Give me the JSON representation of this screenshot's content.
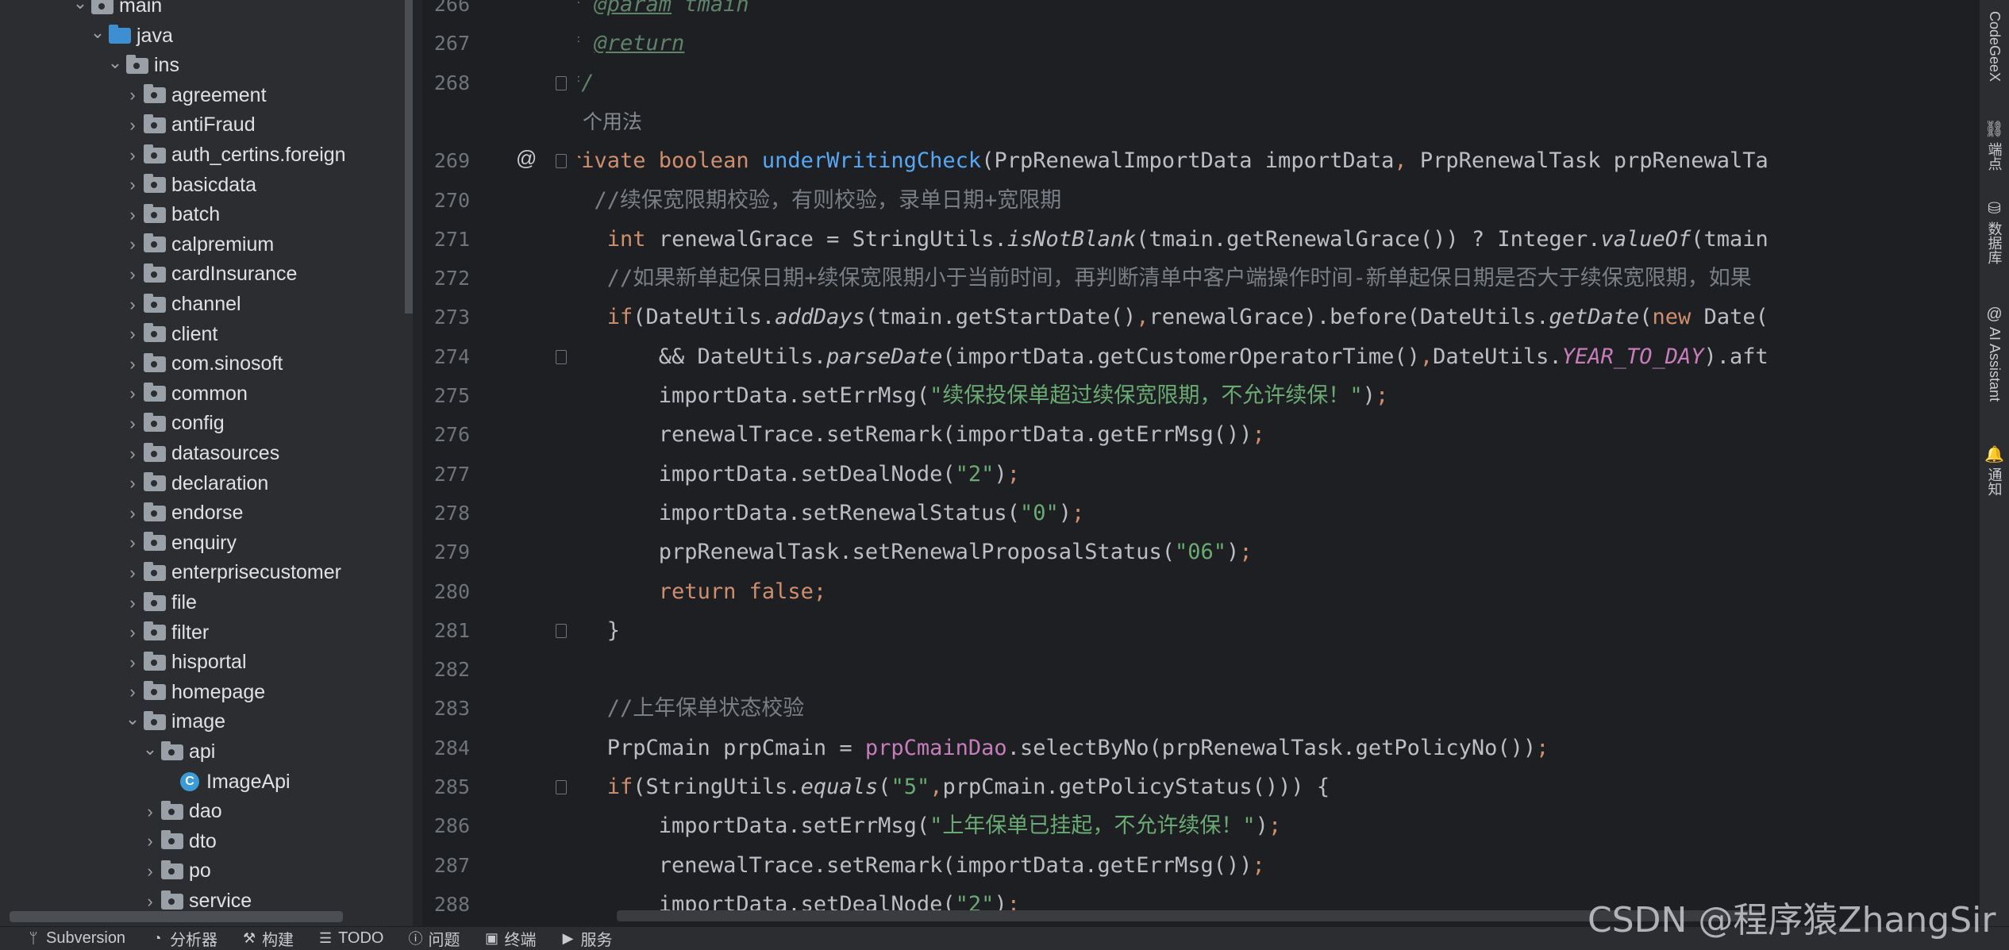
{
  "tree": {
    "items": [
      {
        "label": "main",
        "indent": 0,
        "expanded": true,
        "icon": "folder-icon"
      },
      {
        "label": "java",
        "indent": 1,
        "expanded": true,
        "icon": "source-folder-icon"
      },
      {
        "label": "ins",
        "indent": 2,
        "expanded": true,
        "icon": "package-icon"
      },
      {
        "label": "agreement",
        "indent": 3,
        "expanded": false,
        "icon": "package-icon"
      },
      {
        "label": "antiFraud",
        "indent": 3,
        "expanded": false,
        "icon": "package-icon"
      },
      {
        "label": "auth_certins.foreign",
        "indent": 3,
        "expanded": false,
        "icon": "package-icon"
      },
      {
        "label": "basicdata",
        "indent": 3,
        "expanded": false,
        "icon": "package-icon"
      },
      {
        "label": "batch",
        "indent": 3,
        "expanded": false,
        "icon": "package-icon"
      },
      {
        "label": "calpremium",
        "indent": 3,
        "expanded": false,
        "icon": "package-icon"
      },
      {
        "label": "cardInsurance",
        "indent": 3,
        "expanded": false,
        "icon": "package-icon"
      },
      {
        "label": "channel",
        "indent": 3,
        "expanded": false,
        "icon": "package-icon"
      },
      {
        "label": "client",
        "indent": 3,
        "expanded": false,
        "icon": "package-icon"
      },
      {
        "label": "com.sinosoft",
        "indent": 3,
        "expanded": false,
        "icon": "package-icon"
      },
      {
        "label": "common",
        "indent": 3,
        "expanded": false,
        "icon": "package-icon"
      },
      {
        "label": "config",
        "indent": 3,
        "expanded": false,
        "icon": "package-icon"
      },
      {
        "label": "datasources",
        "indent": 3,
        "expanded": false,
        "icon": "package-icon"
      },
      {
        "label": "declaration",
        "indent": 3,
        "expanded": false,
        "icon": "package-icon"
      },
      {
        "label": "endorse",
        "indent": 3,
        "expanded": false,
        "icon": "package-icon"
      },
      {
        "label": "enquiry",
        "indent": 3,
        "expanded": false,
        "icon": "package-icon"
      },
      {
        "label": "enterprisecustomer",
        "indent": 3,
        "expanded": false,
        "icon": "package-icon"
      },
      {
        "label": "file",
        "indent": 3,
        "expanded": false,
        "icon": "package-icon"
      },
      {
        "label": "filter",
        "indent": 3,
        "expanded": false,
        "icon": "package-icon"
      },
      {
        "label": "hisportal",
        "indent": 3,
        "expanded": false,
        "icon": "package-icon"
      },
      {
        "label": "homepage",
        "indent": 3,
        "expanded": false,
        "icon": "package-icon"
      },
      {
        "label": "image",
        "indent": 3,
        "expanded": true,
        "icon": "package-icon"
      },
      {
        "label": "api",
        "indent": 4,
        "expanded": true,
        "icon": "package-icon"
      },
      {
        "label": "ImageApi",
        "indent": 5,
        "expanded": null,
        "icon": "class-icon"
      },
      {
        "label": "dao",
        "indent": 4,
        "expanded": false,
        "icon": "package-icon"
      },
      {
        "label": "dto",
        "indent": 4,
        "expanded": false,
        "icon": "package-icon"
      },
      {
        "label": "po",
        "indent": 4,
        "expanded": false,
        "icon": "package-icon"
      },
      {
        "label": "service",
        "indent": 4,
        "expanded": false,
        "icon": "package-icon"
      }
    ]
  },
  "editor": {
    "lines": [
      {
        "num": "266",
        "html": "<span class=\"doc\">* </span><span class=\"tag\">@param</span><span class=\"doc\"> tmain</span>"
      },
      {
        "num": "267",
        "html": "<span class=\"doc\">* </span><span class=\"tag\">@return</span>"
      },
      {
        "num": "268",
        "html": "<span class=\"doc\">*/</span>"
      },
      {
        "num": "",
        "html": "<span class=\"hint\">个用法</span>"
      },
      {
        "num": "269",
        "html": "<span class=\"kw\">rivate boolean </span><span class=\"fn\" style=\"color:#56a8f5\">underWritingCheck</span>(PrpRenewalImportData importData<span class=\"kw\">, </span>PrpRenewalTask prpRenewalTa"
      },
      {
        "num": "270",
        "html": "  <span class=\"cm\">//续保宽限期校验，有则校验，录单日期+宽限期</span>"
      },
      {
        "num": "271",
        "html": "   <span class=\"kw\">int </span>renewalGrace = StringUtils.<span class=\"sm\">isNotBlank</span>(tmain.getRenewalGrace()) ? Integer.<span class=\"sm\">valueOf</span>(tmain"
      },
      {
        "num": "272",
        "html": "   <span class=\"cm\">//如果新单起保日期+续保宽限期小于当前时间，再判断清单中客户端操作时间-新单起保日期是否大于续保宽限期，如果</span>"
      },
      {
        "num": "273",
        "html": "   <span class=\"kw\">if</span>(DateUtils.<span class=\"sm\">addDays</span>(tmain.getStartDate()<span class=\"kw\">,</span>renewalGrace).before(DateUtils.<span class=\"sm\">getDate</span>(<span class=\"kw\">new </span>Date("
      },
      {
        "num": "274",
        "html": "       &amp;&amp; DateUtils.<span class=\"sm\">parseDate</span>(importData.getCustomerOperatorTime()<span class=\"kw\">,</span>DateUtils.<span class=\"fd it\">YEAR_TO_DAY</span>).aft"
      },
      {
        "num": "275",
        "html": "       importData.setErrMsg(<span class=\"st\">\"续保投保单超过续保宽限期，不允许续保！\"</span>)<span class=\"kw\">;</span>"
      },
      {
        "num": "276",
        "html": "       renewalTrace.setRemark(importData.getErrMsg())<span class=\"kw\">;</span>"
      },
      {
        "num": "277",
        "html": "       importData.setDealNode(<span class=\"st\">\"2\"</span>)<span class=\"kw\">;</span>"
      },
      {
        "num": "278",
        "html": "       importData.setRenewalStatus(<span class=\"st\">\"0\"</span>)<span class=\"kw\">;</span>"
      },
      {
        "num": "279",
        "html": "       prpRenewalTask.setRenewalProposalStatus(<span class=\"st\">\"06\"</span>)<span class=\"kw\">;</span>"
      },
      {
        "num": "280",
        "html": "       <span class=\"kw\">return false;</span>"
      },
      {
        "num": "281",
        "html": "   }"
      },
      {
        "num": "282",
        "html": ""
      },
      {
        "num": "283",
        "html": "   <span class=\"cm\">//上年保单状态校验</span>"
      },
      {
        "num": "284",
        "html": "   PrpCmain prpCmain = <span class=\"fd\">prpCmainDao</span>.selectByNo(prpRenewalTask.getPolicyNo())<span class=\"kw\">;</span>"
      },
      {
        "num": "285",
        "html": "   <span class=\"kw\">if</span>(StringUtils.<span class=\"sm\">equals</span>(<span class=\"st\">\"5\"</span><span class=\"kw\">,</span>prpCmain.getPolicyStatus())) {"
      },
      {
        "num": "286",
        "html": "       importData.setErrMsg(<span class=\"st\">\"上年保单已挂起，不允许续保！\"</span>)<span class=\"kw\">;</span>"
      },
      {
        "num": "287",
        "html": "       renewalTrace.setRemark(importData.getErrMsg())<span class=\"kw\">;</span>"
      },
      {
        "num": "288",
        "html": "       importData.setDealNode(<span class=\"st\">\"2\"</span>)<span class=\"kw\">;</span>"
      }
    ]
  },
  "rightbar": {
    "items": [
      {
        "label": "CodeGeeX",
        "icon": "codegeex-icon"
      },
      {
        "label": "端点",
        "icon": "endpoints-icon"
      },
      {
        "label": "数据库",
        "icon": "database-icon"
      },
      {
        "label": "AI Assistant",
        "icon": "ai-assistant-icon"
      },
      {
        "label": "通知",
        "icon": "bell-icon"
      }
    ]
  },
  "statusbar": {
    "items": [
      {
        "label": "Subversion",
        "icon": "subversion-icon",
        "glyph": "ᛘ"
      },
      {
        "label": "分析器",
        "icon": "profiler-icon",
        "glyph": "◔"
      },
      {
        "label": "构建",
        "icon": "hammer-icon",
        "glyph": "⚒"
      },
      {
        "label": "TODO",
        "icon": "todo-list-icon",
        "glyph": "☰"
      },
      {
        "label": "问题",
        "icon": "problems-icon",
        "glyph": "ⓘ"
      },
      {
        "label": "终端",
        "icon": "terminal-icon",
        "glyph": "▣"
      },
      {
        "label": "服务",
        "icon": "services-icon",
        "glyph": "▶"
      }
    ]
  },
  "watermark": "CSDN @程序猿ZhangSir",
  "colors": {
    "keyword": "#cf8e6d",
    "method": "#56a8f5",
    "string": "#6aab73",
    "comment": "#7a7e85",
    "field": "#c77dbb",
    "background": "#1e1f22"
  }
}
